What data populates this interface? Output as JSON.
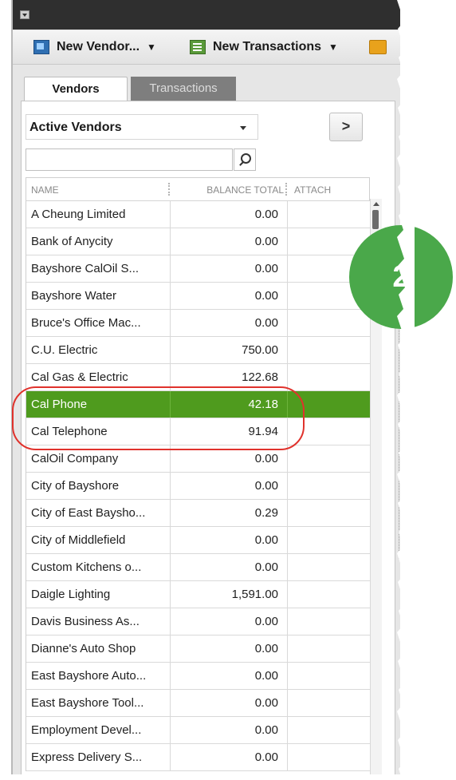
{
  "toolbar": {
    "new_vendor_label": "New Vendor...",
    "new_transactions_label": "New Transactions",
    "caret": "▼"
  },
  "tabs": {
    "vendors": "Vendors",
    "transactions": "Transactions"
  },
  "filter": {
    "selected": "Active Vendors",
    "next_label": ">"
  },
  "search": {
    "value": "",
    "placeholder": ""
  },
  "columns": {
    "name": "NAME",
    "balance": "BALANCE TOTAL",
    "attach": "ATTACH"
  },
  "vendors": [
    {
      "name": "A Cheung Limited",
      "balance": "0.00"
    },
    {
      "name": "Bank of Anycity",
      "balance": "0.00"
    },
    {
      "name": "Bayshore CalOil S...",
      "balance": "0.00"
    },
    {
      "name": "Bayshore Water",
      "balance": "0.00"
    },
    {
      "name": "Bruce's Office Mac...",
      "balance": "0.00"
    },
    {
      "name": "C.U. Electric",
      "balance": "750.00"
    },
    {
      "name": "Cal Gas & Electric",
      "balance": "122.68"
    },
    {
      "name": "Cal Phone",
      "balance": "42.18"
    },
    {
      "name": "Cal Telephone",
      "balance": "91.94"
    },
    {
      "name": "CalOil Company",
      "balance": "0.00"
    },
    {
      "name": "City of Bayshore",
      "balance": "0.00"
    },
    {
      "name": "City of East Baysho...",
      "balance": "0.29"
    },
    {
      "name": "City of Middlefield",
      "balance": "0.00"
    },
    {
      "name": "Custom Kitchens o...",
      "balance": "0.00"
    },
    {
      "name": "Daigle Lighting",
      "balance": "1,591.00"
    },
    {
      "name": "Davis Business As...",
      "balance": "0.00"
    },
    {
      "name": "Dianne's Auto Shop",
      "balance": "0.00"
    },
    {
      "name": "East Bayshore Auto...",
      "balance": "0.00"
    },
    {
      "name": "East Bayshore Tool...",
      "balance": "0.00"
    },
    {
      "name": "Employment Devel...",
      "balance": "0.00"
    },
    {
      "name": "Express Delivery S...",
      "balance": "0.00"
    }
  ],
  "selected_row": 7,
  "badge": {
    "label": "2",
    "color": "#4aa84a"
  },
  "colors": {
    "selection": "#4f9b1e",
    "annotation": "#e0322c"
  },
  "icons": {
    "vendor": "new-vendor-icon",
    "transactions": "new-transactions-icon",
    "print": "print-icon",
    "search": "search-icon"
  }
}
